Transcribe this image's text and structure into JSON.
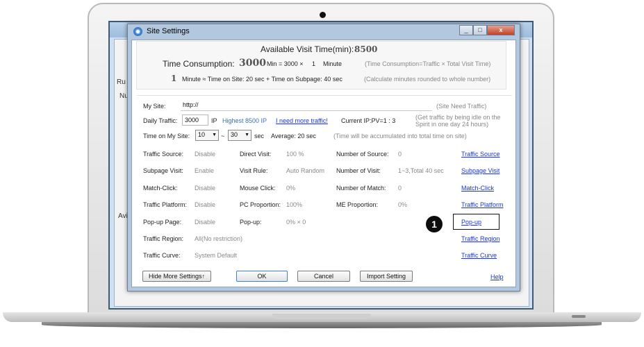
{
  "dialog": {
    "title": "Site Settings",
    "minimize": "_",
    "maximize": "□",
    "close": "x"
  },
  "background_window": {
    "left_labels": [
      "Ru",
      "Nu",
      "Avi"
    ]
  },
  "summary": {
    "available_label": "Available Visit Time(min):",
    "available_value": "8500",
    "consumption_label": "Time Consumption:",
    "consumption_value": "3000",
    "consumption_formula": "Min = 3000 ×",
    "consumption_factor": "1",
    "consumption_unit": "Minute",
    "consumption_note": "(Time Consumption=Traffic × Total Visit Time)",
    "minute_value": "1",
    "minute_equation": "Minute ≈ Time on Site: 20 sec + Time on Subpage: 40 sec",
    "minute_note": "(Calculate minutes rounded to whole number)"
  },
  "my_site": {
    "label": "My Site:",
    "value": "http://",
    "note": "(Site Need Traffic)"
  },
  "daily_traffic": {
    "label": "Daily Traffic:",
    "value": "3000",
    "ip_label": "IP",
    "highest": "Highest 8500 IP",
    "need_more_link": "I need more traffic!",
    "current_ip": "Current IP:PV=1 : 3",
    "note_line1": "(Get traffic by being idle on the",
    "note_line2": "Spirit in one day 24 hours)"
  },
  "time_on_site": {
    "label": "Time on My Site:",
    "min_value": "10",
    "tilde": "~",
    "max_value": "30",
    "unit": "sec",
    "average": "Average: 20 sec",
    "note": "(Time will be accumulated into total time on site)"
  },
  "settings_rows": [
    {
      "label": "Traffic Source:",
      "value": "Disable",
      "label2": "Direct Visit:",
      "value2": "100 %",
      "label3": "Number of Source:",
      "value3": "0",
      "link": "Traffic Source"
    },
    {
      "label": "Subpage Visit:",
      "value": "Enable",
      "label2": "Visit Rule:",
      "value2": "Auto Random",
      "label3": "Number of Visit:",
      "value3": "1~3,Total 40 sec",
      "link": "Subpage Visit"
    },
    {
      "label": "Match-Click:",
      "value": "Disable",
      "label2": "Mouse Click:",
      "value2": "0%",
      "label3": "Number of Match:",
      "value3": "0",
      "link": "Match-Click"
    },
    {
      "label": "Traffic Platform:",
      "value": "Disable",
      "label2": "PC Proportion:",
      "value2": "100%",
      "label3": "ME Proportion:",
      "value3": "0%",
      "link": "Traffic Platform"
    },
    {
      "label": "Pop-up Page:",
      "value": "Disable",
      "label2": "Pop-up:",
      "value2": "0% × 0",
      "label3": "",
      "value3": "",
      "link": "Pop-up"
    },
    {
      "label": "Traffic Region:",
      "value": "All(No restriction)",
      "label2": "",
      "value2": "",
      "label3": "",
      "value3": "",
      "link": "Traffic Region"
    },
    {
      "label": "Traffic Curve:",
      "value": "System Default",
      "label2": "",
      "value2": "",
      "label3": "",
      "value3": "",
      "link": "Traffic Curve"
    }
  ],
  "buttons": {
    "hide_more": "Hide More Settings↑",
    "ok": "OK",
    "cancel": "Cancel",
    "import": "Import Setting",
    "help": "Help"
  },
  "callout": {
    "number": "1"
  },
  "colors": {
    "link": "#1a35d6",
    "dialog_frame": "#b3c7de",
    "badge": "#0d0d0d"
  }
}
